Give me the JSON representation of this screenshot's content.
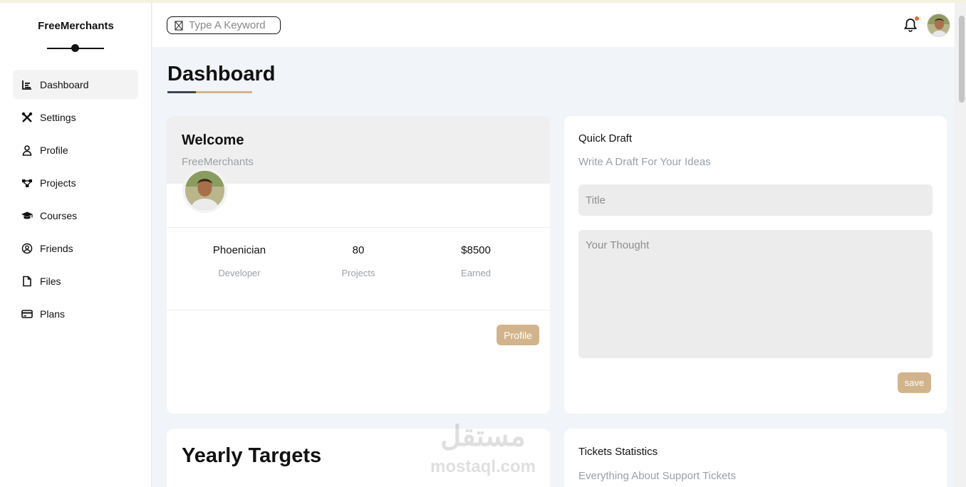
{
  "sidebar": {
    "brand": "FreeMerchants",
    "items": [
      {
        "label": "Dashboard",
        "icon": "chart-icon"
      },
      {
        "label": "Settings",
        "icon": "tools-icon"
      },
      {
        "label": "Profile",
        "icon": "user-icon"
      },
      {
        "label": "Projects",
        "icon": "diagram-icon"
      },
      {
        "label": "Courses",
        "icon": "graduation-cap-icon"
      },
      {
        "label": "Friends",
        "icon": "user-circle-icon"
      },
      {
        "label": "Files",
        "icon": "file-icon"
      },
      {
        "label": "Plans",
        "icon": "credit-card-icon"
      }
    ]
  },
  "header": {
    "search_placeholder": "Type A Keyword",
    "notification_icon": "bell-icon"
  },
  "main": {
    "title": "Dashboard",
    "welcome": {
      "title": "Welcome",
      "subtitle": "FreeMerchants",
      "stats": [
        {
          "value": "Phoenician",
          "label": "Developer"
        },
        {
          "value": "80",
          "label": "Projects"
        },
        {
          "value": "$8500",
          "label": "Earned"
        }
      ],
      "button_label": "Profile"
    },
    "quick_draft": {
      "title": "Quick Draft",
      "subtitle": "Write A Draft For Your Ideas",
      "title_placeholder": "Title",
      "thought_placeholder": "Your Thought",
      "save_label": "save"
    },
    "yearly_targets": {
      "title": "Yearly Targets"
    },
    "tickets": {
      "title": "Tickets Statistics",
      "subtitle": "Everything About Support Tickets"
    }
  },
  "watermark": {
    "arabic": "مستقل",
    "latin": "mostaql.com"
  },
  "colors": {
    "accent": "#d2b48c",
    "dark": "#3d4654",
    "background": "#f1f4f8",
    "notification": "#e8692b"
  }
}
